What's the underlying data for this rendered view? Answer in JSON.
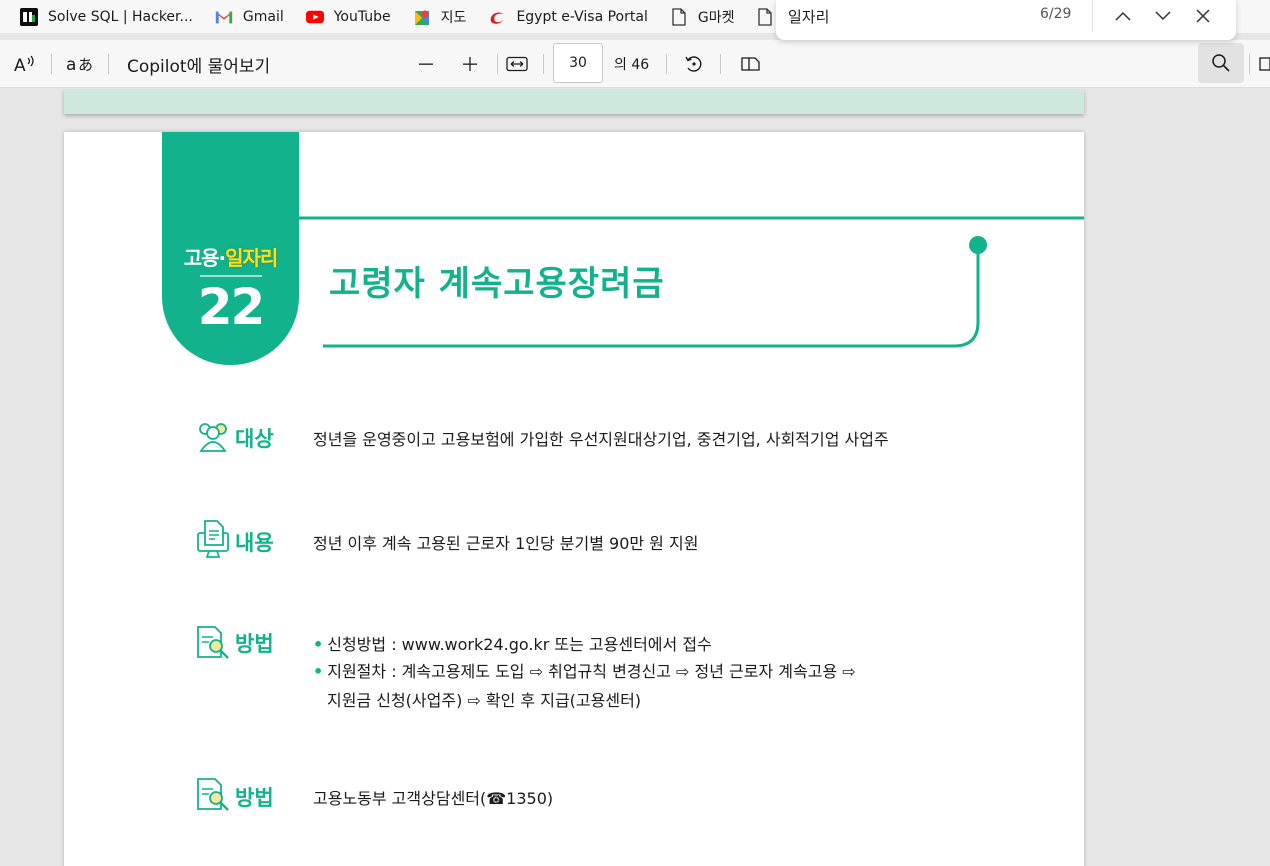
{
  "bookmarks": [
    {
      "label": "Solve SQL | Hacker...",
      "icon": "hackerrank-icon"
    },
    {
      "label": "Gmail",
      "icon": "gmail-icon"
    },
    {
      "label": "YouTube",
      "icon": "youtube-icon"
    },
    {
      "label": "지도",
      "icon": "maps-icon"
    },
    {
      "label": "Egypt e-Visa Portal",
      "icon": "egypt-evisa-icon"
    },
    {
      "label": "G마켓",
      "icon": "document-icon"
    },
    {
      "label": "",
      "icon": "document-icon"
    }
  ],
  "find": {
    "query": "일자리",
    "count": "6/29"
  },
  "toolbar": {
    "copilot_label": "Copilot에 물어보기",
    "page_current": "30",
    "page_total": "의 46"
  },
  "document": {
    "badge_category": "고용·",
    "badge_highlight": "일자리",
    "badge_number": "22",
    "title": "고령자 계속고용장려금",
    "rows": [
      {
        "label": "대상",
        "icon": "people-icon",
        "text": "정년을 운영중이고 고용보험에 가입한 우선지원대상기업, 중견기업, 사회적기업 사업주"
      },
      {
        "label": "내용",
        "icon": "document-monitor-icon",
        "text": "정년 이후 계속 고용된 근로자 1인당 분기별 90만 원 지원"
      },
      {
        "label": "방법",
        "icon": "magnifier-doc-icon",
        "bullets": [
          "신청방법 : www.work24.go.kr 또는 고용센터에서 접수",
          "지원절차 : 계속고용제도 도입 ⇨ 취업규칙 변경신고 ⇨ 정년 근로자 계속고용 ⇨",
          "지원금 신청(사업주) ⇨ 확인 후 지급(고용센터)"
        ]
      },
      {
        "label": "방법",
        "icon": "magnifier-doc-icon",
        "text": "고용노동부 고객상담센터(☎1350)"
      }
    ]
  },
  "colors": {
    "accent": "#12b28c",
    "highlight": "#f3e32a",
    "prev_page": "#cfe8dd"
  }
}
